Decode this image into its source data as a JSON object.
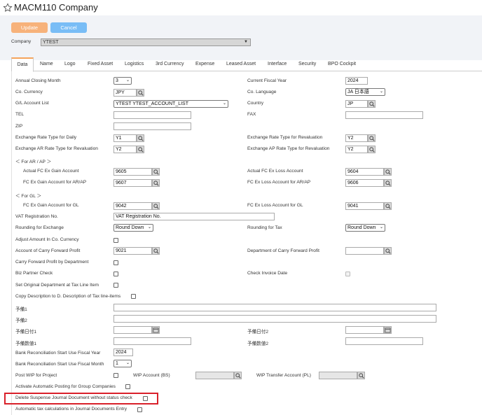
{
  "title": "MACM110 Company",
  "toolbar": {
    "update": "Update",
    "cancel": "Cancel",
    "company_label": "Company",
    "company_value": "YTEST"
  },
  "tabs": [
    "Data",
    "Name",
    "Logo",
    "Fixed Asset",
    "Logistics",
    "3rd Currency",
    "Expense",
    "Leased Asset",
    "Interface",
    "Security",
    "BPO Cockpit"
  ],
  "form": {
    "annual_closing_month": {
      "label": "Annual Closing Month",
      "value": "3"
    },
    "current_fiscal_year": {
      "label": "Current Fiscal Year",
      "value": "2024"
    },
    "co_currency": {
      "label": "Co. Currency",
      "value": "JPY"
    },
    "co_language": {
      "label": "Co. Language",
      "value": "JA 日本語"
    },
    "gl_account_list": {
      "label": "G/L Account List",
      "value": "YTEST YTEST_ACCOUNT_LIST"
    },
    "country": {
      "label": "Country",
      "value": "JP"
    },
    "tel": {
      "label": "TEL",
      "value": ""
    },
    "fax": {
      "label": "FAX",
      "value": ""
    },
    "zip": {
      "label": "ZIP",
      "value": ""
    },
    "rate_daily": {
      "label": "Exchange Rate Type for Daily",
      "value": "Y1"
    },
    "rate_revaluation": {
      "label": "Exchange Rate Type for Revaluation",
      "value": "Y2"
    },
    "ar_rate": {
      "label": "Exchange AR Rate Type for Revaluation",
      "value": "Y2"
    },
    "ap_rate": {
      "label": "Exchange AP Rate Type for Revaluation",
      "value": "Y2"
    },
    "for_arap": "＜ For AR / AP ＞",
    "fc_gain": {
      "label": "Actual FC Ex Gain Account",
      "value": "9605"
    },
    "fc_loss": {
      "label": "Actual FC Ex Loss Account",
      "value": "9604"
    },
    "fc_gain_arap": {
      "label": "FC Ex Gain Account for AR/AP",
      "value": "9607"
    },
    "fc_loss_arap": {
      "label": "FC Ex Loss Account for AR/AP",
      "value": "9606"
    },
    "for_gl": "＜ For GL ＞",
    "fc_gain_gl": {
      "label": "FC Ex Gain Account for GL",
      "value": "9042"
    },
    "fc_loss_gl": {
      "label": "FC Ex Loss Account for GL",
      "value": "9041"
    },
    "vat_no": {
      "label": "VAT Registration No.",
      "value": "VAT Registration No."
    },
    "rounding_exchange": {
      "label": "Rounding for Exchange",
      "value": "Round Down"
    },
    "rounding_tax": {
      "label": "Rounding for Tax",
      "value": "Round Down"
    },
    "adjust_amount": {
      "label": "Adjust Amount In Co. Currency"
    },
    "carry_forward_acct": {
      "label": "Account of Carry Forward Profit",
      "value": "9021"
    },
    "dept_carry_forward": {
      "label": "Department of Carry Forward Profit",
      "value": ""
    },
    "carry_forward_by_dept": {
      "label": "Carry Forward Profit by Department"
    },
    "biz_partner_check": {
      "label": "Biz Partner Check"
    },
    "check_invoice_date": {
      "label": "Check Invoice Date"
    },
    "set_original_dept": {
      "label": "Set Original Department at Tax Line Item"
    },
    "copy_description": {
      "label": "Copy Description to D. Description of Tax line-items"
    },
    "spare1": {
      "label": "予備1",
      "value": ""
    },
    "spare2": {
      "label": "予備2",
      "value": ""
    },
    "spare_date1": {
      "label": "予備日付1",
      "value": ""
    },
    "spare_date2": {
      "label": "予備日付2",
      "value": ""
    },
    "spare_num1": {
      "label": "予備数値1",
      "value": ""
    },
    "spare_num2": {
      "label": "予備数値2",
      "value": ""
    },
    "bank_recon_year": {
      "label": "Bank Reconciliation Start Use Fiscal Year",
      "value": "2024"
    },
    "bank_recon_month": {
      "label": "Bank Reconciliation Start Use Fiscal Month",
      "value": "1"
    },
    "post_wip": {
      "label": "Post WIP for Project"
    },
    "wip_bs": {
      "label": "WIP Account (BS)",
      "value": ""
    },
    "wip_transfer": {
      "label": "WIP Transfer Account (PL)",
      "value": ""
    },
    "auto_posting_group": {
      "label": "Activate Automatic Posting for Group Companies"
    },
    "delete_suspense": {
      "label": "Delete Suspense Journal Document without status check"
    },
    "auto_tax": {
      "label": "Automatic tax calculations in Journal Documents Entry"
    }
  },
  "colors": {
    "update_button": "#f7b27b",
    "cancel_button": "#79bdf6",
    "active_tab_accent": "#f5a35b",
    "highlight_box": "#d9202a",
    "toolbar_bg": "#f1f3f7"
  }
}
